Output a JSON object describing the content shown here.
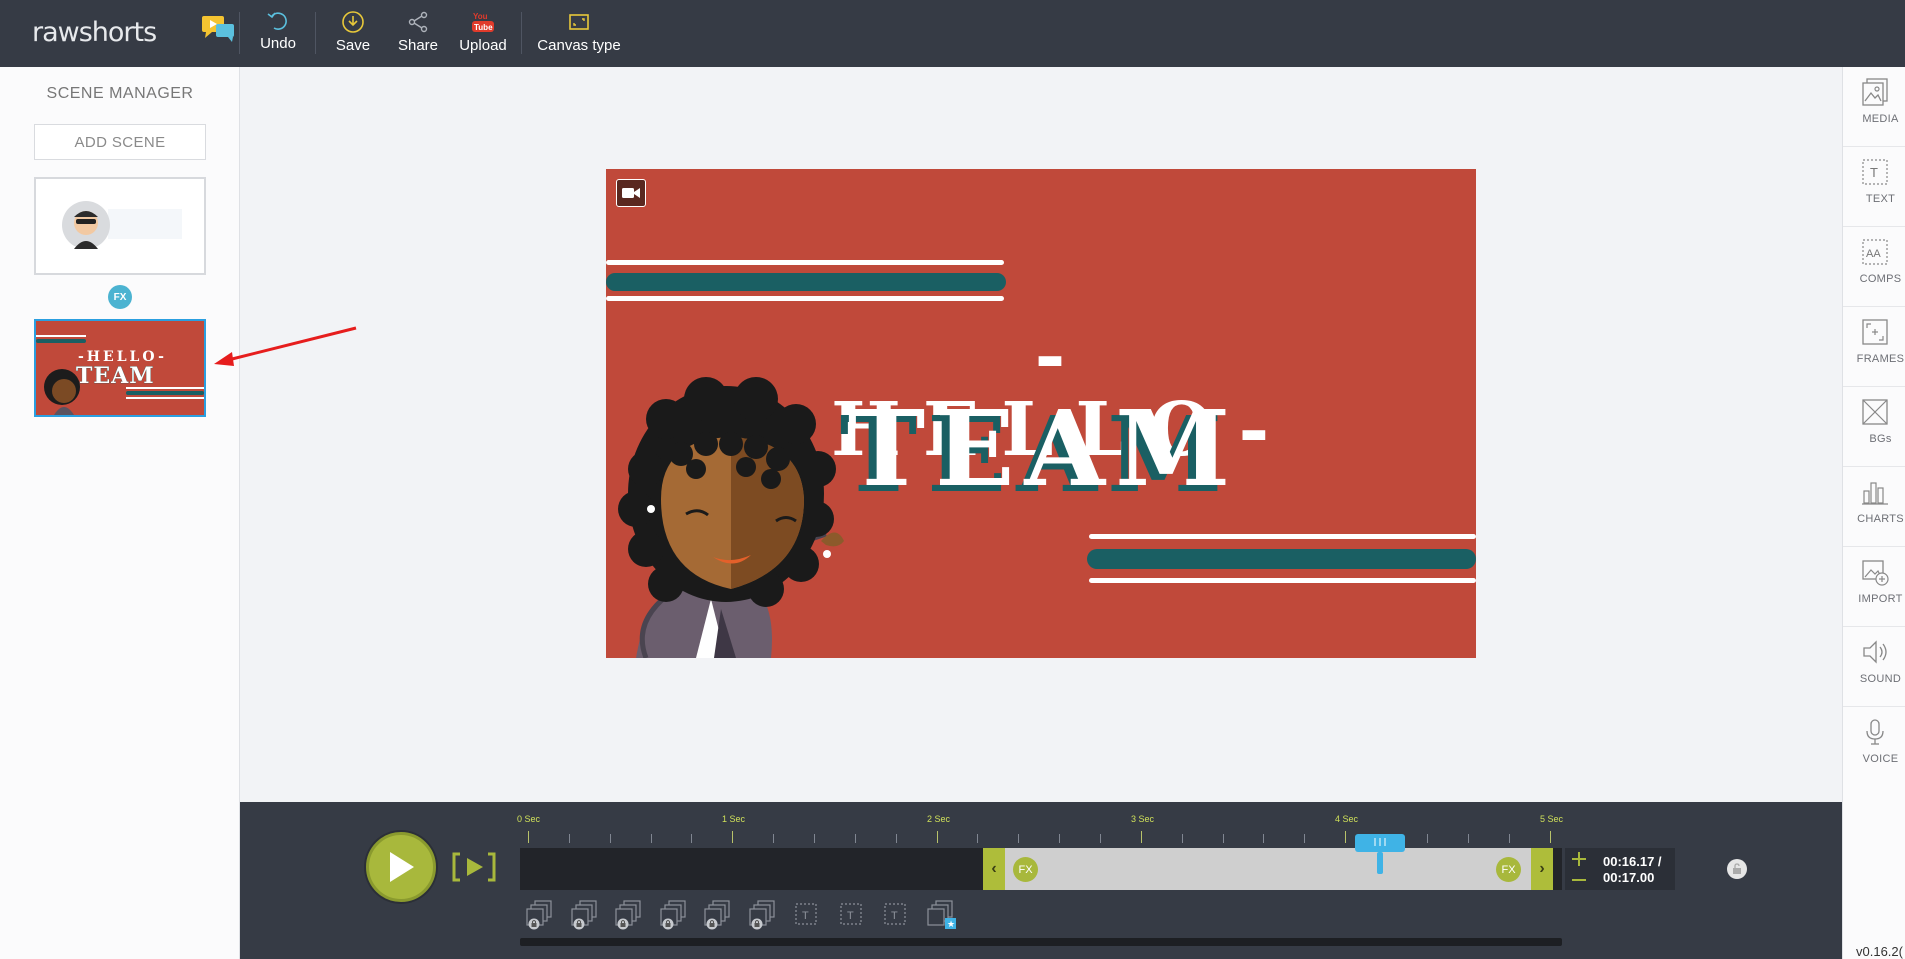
{
  "app": {
    "logo_text": "rawshorts",
    "version": "v0.16.2("
  },
  "toolbar": {
    "items": [
      {
        "label": "Undo",
        "icon": "undo-icon"
      },
      {
        "label": "Save",
        "icon": "download-circle-icon"
      },
      {
        "label": "Share",
        "icon": "share-icon"
      },
      {
        "label": "Upload",
        "icon": "youtube-icon"
      },
      {
        "label": "Canvas type",
        "icon": "canvas-frame-icon"
      }
    ]
  },
  "scene_manager": {
    "title": "SCENE MANAGER",
    "add_scene_label": "ADD SCENE",
    "transition_badge": "FX",
    "scenes": [
      {
        "selected": false
      },
      {
        "selected": true,
        "hello": "-HELLO-",
        "team": "TEAM"
      }
    ]
  },
  "canvas": {
    "hello_text": "-HELLO-",
    "team_text": "TEAM",
    "bg_color": "#c0493a",
    "accent_color": "#1a5f63"
  },
  "right_panel": {
    "items": [
      {
        "label": "MEDIA",
        "icon": "media-icon"
      },
      {
        "label": "TEXT",
        "icon": "text-icon"
      },
      {
        "label": "COMPS",
        "icon": "comps-icon"
      },
      {
        "label": "FRAMES",
        "icon": "frames-icon"
      },
      {
        "label": "BGs",
        "icon": "background-icon"
      },
      {
        "label": "CHARTS",
        "icon": "charts-icon"
      },
      {
        "label": "IMPORT",
        "icon": "import-icon"
      },
      {
        "label": "SOUND",
        "icon": "sound-icon"
      },
      {
        "label": "VOICE",
        "icon": "microphone-icon"
      }
    ]
  },
  "timeline": {
    "ruler_labels": [
      "0 Sec",
      "1 Sec",
      "2 Sec",
      "3 Sec",
      "4 Sec",
      "5 Sec"
    ],
    "clip_start_fx": "FX",
    "clip_end_fx": "FX",
    "current_time": "00:16.17 /",
    "total_time": "00:17.00",
    "accent_color": "#a8b83c",
    "playhead_color": "#3fb3e6"
  }
}
